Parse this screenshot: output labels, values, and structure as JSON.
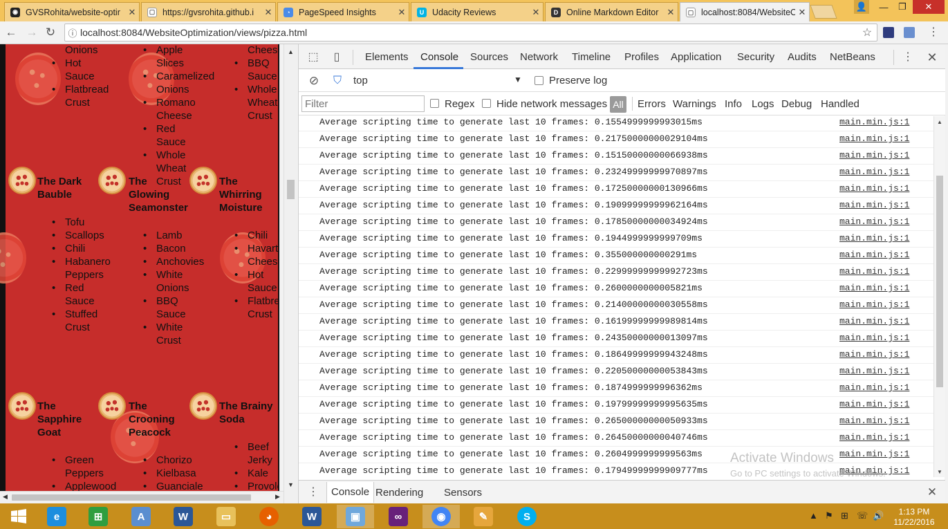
{
  "browser": {
    "tabs": [
      {
        "title": "GVSRohita/website-optir",
        "icon": "github-icon",
        "color": "#222222",
        "glyph": "◉"
      },
      {
        "title": "https://gvsrohita.github.i",
        "icon": "page-icon",
        "color": "#ffffff",
        "glyph": "▢"
      },
      {
        "title": "PageSpeed Insights",
        "icon": "pagespeed-icon",
        "color": "#4a8be8",
        "glyph": "◔"
      },
      {
        "title": "Udacity Reviews",
        "icon": "udacity-icon",
        "color": "#02b3e4",
        "glyph": "U"
      },
      {
        "title": "Online Markdown Editor",
        "icon": "markdown-editor-icon",
        "color": "#333333",
        "glyph": "D"
      },
      {
        "title": "localhost:8084/WebsiteO",
        "icon": "page-icon",
        "color": "#ffffff",
        "glyph": "▢"
      }
    ],
    "tab_close": "✕",
    "window": {
      "user": "👤",
      "minimize": "—",
      "maximize": "❐",
      "close": "✕"
    },
    "nav": {
      "back": "←",
      "forward": "→",
      "reload": "↻"
    },
    "url": "localhost:8084/WebsiteOptimization/views/pizza.html",
    "page_info": "ⓘ",
    "star": "☆"
  },
  "page": {
    "pizzas": [
      {
        "name_lines": [
          "The Dark",
          "Bauble"
        ]
      },
      {
        "name_lines": [
          "The",
          "Glowing",
          "Seamonster"
        ]
      },
      {
        "name_lines": [
          "The",
          "Whirring",
          "Moisture"
        ]
      },
      {
        "name_lines": [
          "The",
          "Sapphire",
          "Goat"
        ]
      },
      {
        "name_lines": [
          "The",
          "Crooning",
          "Peacock"
        ]
      },
      {
        "name_lines": [
          "The Brainy",
          "Soda"
        ]
      }
    ],
    "ingredient_lists": [
      {
        "items": [
          {
            "t": "Onions",
            "b": false
          },
          {
            "t": "Hot",
            "b": true
          },
          {
            "t": "Sauce",
            "b": false
          },
          {
            "t": "Flatbread",
            "b": true
          },
          {
            "t": "Crust",
            "b": false
          }
        ]
      },
      {
        "items": [
          {
            "t": "Apple",
            "b": true
          },
          {
            "t": "Slices",
            "b": false
          },
          {
            "t": "Caramelized",
            "b": true
          },
          {
            "t": "Onions",
            "b": false
          },
          {
            "t": "Romano",
            "b": true
          },
          {
            "t": "Cheese",
            "b": false
          },
          {
            "t": "Red",
            "b": true
          },
          {
            "t": "Sauce",
            "b": false
          },
          {
            "t": "Whole",
            "b": true
          },
          {
            "t": "Wheat",
            "b": false
          },
          {
            "t": "Crust",
            "b": false
          }
        ]
      },
      {
        "items": [
          {
            "t": "Cheese",
            "b": false
          },
          {
            "t": "BBQ",
            "b": true
          },
          {
            "t": "Sauce",
            "b": false
          },
          {
            "t": "Whole",
            "b": true
          },
          {
            "t": "Wheat",
            "b": false
          },
          {
            "t": "Crust",
            "b": false
          }
        ]
      },
      {
        "items": [
          {
            "t": "Tofu",
            "b": true
          },
          {
            "t": "Scallops",
            "b": true
          },
          {
            "t": "Chili",
            "b": true
          },
          {
            "t": "Habanero",
            "b": true
          },
          {
            "t": "Peppers",
            "b": false
          },
          {
            "t": "Red",
            "b": true
          },
          {
            "t": "Sauce",
            "b": false
          },
          {
            "t": "Stuffed",
            "b": true
          },
          {
            "t": "Crust",
            "b": false
          }
        ]
      },
      {
        "items": [
          {
            "t": "Lamb",
            "b": true
          },
          {
            "t": "Bacon",
            "b": true
          },
          {
            "t": "Anchovies",
            "b": true
          },
          {
            "t": "White",
            "b": true
          },
          {
            "t": "Onions",
            "b": false
          },
          {
            "t": "BBQ",
            "b": true
          },
          {
            "t": "Sauce",
            "b": false
          },
          {
            "t": "White",
            "b": true
          },
          {
            "t": "Crust",
            "b": false
          }
        ]
      },
      {
        "items": [
          {
            "t": "Chili",
            "b": true
          },
          {
            "t": "Havarti",
            "b": true
          },
          {
            "t": "Cheese",
            "b": false
          },
          {
            "t": "Hot",
            "b": true
          },
          {
            "t": "Sauce",
            "b": false
          },
          {
            "t": "Flatbread",
            "b": true
          },
          {
            "t": "Crust",
            "b": false
          }
        ]
      },
      {
        "items": [
          {
            "t": "Green",
            "b": true
          },
          {
            "t": "Peppers",
            "b": false
          },
          {
            "t": "Applewood",
            "b": true
          }
        ]
      },
      {
        "items": [
          {
            "t": "Chorizo",
            "b": true
          },
          {
            "t": "Kielbasa",
            "b": true
          },
          {
            "t": "Guanciale",
            "b": true
          }
        ]
      },
      {
        "items": [
          {
            "t": "Beef",
            "b": true
          },
          {
            "t": "Jerky",
            "b": false
          },
          {
            "t": "Kale",
            "b": true
          },
          {
            "t": "Provolone",
            "b": true
          }
        ]
      }
    ]
  },
  "devtools": {
    "tabs": [
      "Elements",
      "Console",
      "Sources",
      "Network",
      "Timeline",
      "Profiles",
      "Application",
      "Security",
      "Audits",
      "NetBeans"
    ],
    "active_tab": "Console",
    "menu_icon": "⋮",
    "close_icon": "✕",
    "context": "top",
    "preserve_log": "Preserve log",
    "filter_placeholder": "Filter",
    "regex": "Regex",
    "hide_network": "Hide network messages",
    "levels": [
      "All",
      "Errors",
      "Warnings",
      "Info",
      "Logs",
      "Debug",
      "Handled"
    ],
    "log_source": "main.min.js:1",
    "logs": [
      "Average scripting time to generate last 10 frames: 0.1554999999993015ms",
      "Average scripting time to generate last 10 frames: 0.21750000000029104ms",
      "Average scripting time to generate last 10 frames: 0.15150000000066938ms",
      "Average scripting time to generate last 10 frames: 0.23249999999970897ms",
      "Average scripting time to generate last 10 frames: 0.17250000000130966ms",
      "Average scripting time to generate last 10 frames: 0.19099999999962164ms",
      "Average scripting time to generate last 10 frames: 0.17850000000034924ms",
      "Average scripting time to generate last 10 frames: 0.1944999999999709ms",
      "Average scripting time to generate last 10 frames: 0.355000000000291ms",
      "Average scripting time to generate last 10 frames: 0.22999999999992723ms",
      "Average scripting time to generate last 10 frames: 0.2600000000005821ms",
      "Average scripting time to generate last 10 frames: 0.21400000000030558ms",
      "Average scripting time to generate last 10 frames: 0.16199999999989814ms",
      "Average scripting time to generate last 10 frames: 0.24350000000013097ms",
      "Average scripting time to generate last 10 frames: 0.18649999999943248ms",
      "Average scripting time to generate last 10 frames: 0.22050000000053843ms",
      "Average scripting time to generate last 10 frames: 0.1874999999996362ms",
      "Average scripting time to generate last 10 frames: 0.19799999999995635ms",
      "Average scripting time to generate last 10 frames: 0.26500000000050933ms",
      "Average scripting time to generate last 10 frames: 0.26450000000040746ms",
      "Average scripting time to generate last 10 frames: 0.2604999999999563ms",
      "Average scripting time to generate last 10 frames: 0.17949999999909777ms"
    ],
    "drawer_tabs": [
      "Console",
      "Rendering",
      "Sensors"
    ],
    "drawer_menu": "⋮",
    "drawer_close": "✕"
  },
  "watermark": {
    "title": "Activate Windows",
    "subtitle": "Go to PC settings to activate Windows."
  },
  "taskbar": {
    "start_icon": "windows-start-icon",
    "apps": [
      {
        "name": "internet-explorer-icon",
        "color": "#1c8ede",
        "glyph": "e"
      },
      {
        "name": "store-icon",
        "color": "#2f9e3f",
        "glyph": "⊞"
      },
      {
        "name": "notepad-icon",
        "color": "#5a8ed0",
        "glyph": "A"
      },
      {
        "name": "word-icon",
        "color": "#2b5797",
        "glyph": "W"
      },
      {
        "name": "file-explorer-icon",
        "color": "#e8c15b",
        "glyph": "▭"
      },
      {
        "name": "firefox-icon",
        "color": "#e66000",
        "glyph": "◕"
      },
      {
        "name": "word-doc-icon",
        "color": "#2b5797",
        "glyph": "W"
      },
      {
        "name": "virtualbox-icon",
        "color": "#6fa8dc",
        "glyph": "▣"
      },
      {
        "name": "visual-studio-icon",
        "color": "#68217a",
        "glyph": "∞"
      },
      {
        "name": "chrome-icon",
        "color": "#4285f4",
        "glyph": "◉"
      },
      {
        "name": "paint-icon",
        "color": "#e6a63c",
        "glyph": "✎"
      },
      {
        "name": "skype-icon",
        "color": "#00aff0",
        "glyph": "S"
      }
    ],
    "tray": [
      "▲",
      "⚑",
      "⊞",
      "☏",
      "🔊"
    ],
    "time": "1:13 PM",
    "date": "11/22/2016"
  }
}
